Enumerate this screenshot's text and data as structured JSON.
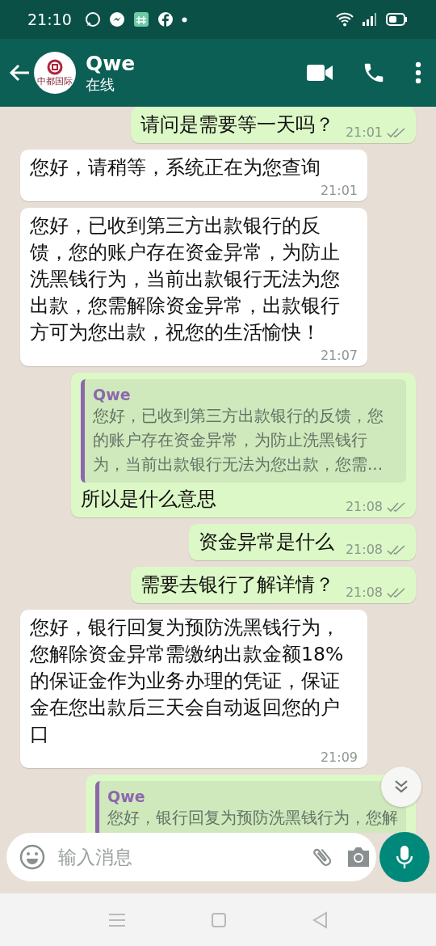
{
  "status_bar": {
    "time": "21:10"
  },
  "header": {
    "name": "Qwe",
    "status": "在线",
    "avatar_text": "中都国际"
  },
  "messages": [
    {
      "kind": "outgoing",
      "text": "请问是需要等一天吗？",
      "time": "21:01",
      "read": false
    },
    {
      "kind": "incoming",
      "text": "您好，请稍等，系统正在为您查询",
      "time": "21:01"
    },
    {
      "kind": "incoming",
      "text": "您好，已收到第三方出款银行的反馈，您的账户存在资金异常，为防止洗黑钱行为，当前出款银行无法为您出款，您需解除资金异常，出款银行方可为您出款，祝您的生活愉快！",
      "time": "21:07"
    },
    {
      "kind": "outgoing",
      "quote": {
        "author": "Qwe",
        "text": "您好，已收到第三方出款银行的反馈，您的账户存在资金异常，为防止洗黑钱行为，当前出款银行无法为您出款，您需..."
      },
      "text": "所以是什么意思",
      "time": "21:08",
      "read": false
    },
    {
      "kind": "outgoing",
      "text": "资金异常是什么",
      "time": "21:08",
      "read": false
    },
    {
      "kind": "outgoing",
      "text": "需要去银行了解详情？",
      "time": "21:08",
      "read": false
    },
    {
      "kind": "incoming",
      "text": "您好，银行回复为预防洗黑钱行为，您解除资金异常需缴纳出款金额18%的保证金作为业务办理的凭证，保证金在您出款后三天会自动返回您的户口",
      "time": "21:09"
    },
    {
      "kind": "outgoing",
      "quote": {
        "author": "Qwe",
        "text": "您好，银行回复为预防洗黑钱行为，您解"
      }
    }
  ],
  "composer": {
    "placeholder": "输入消息"
  }
}
